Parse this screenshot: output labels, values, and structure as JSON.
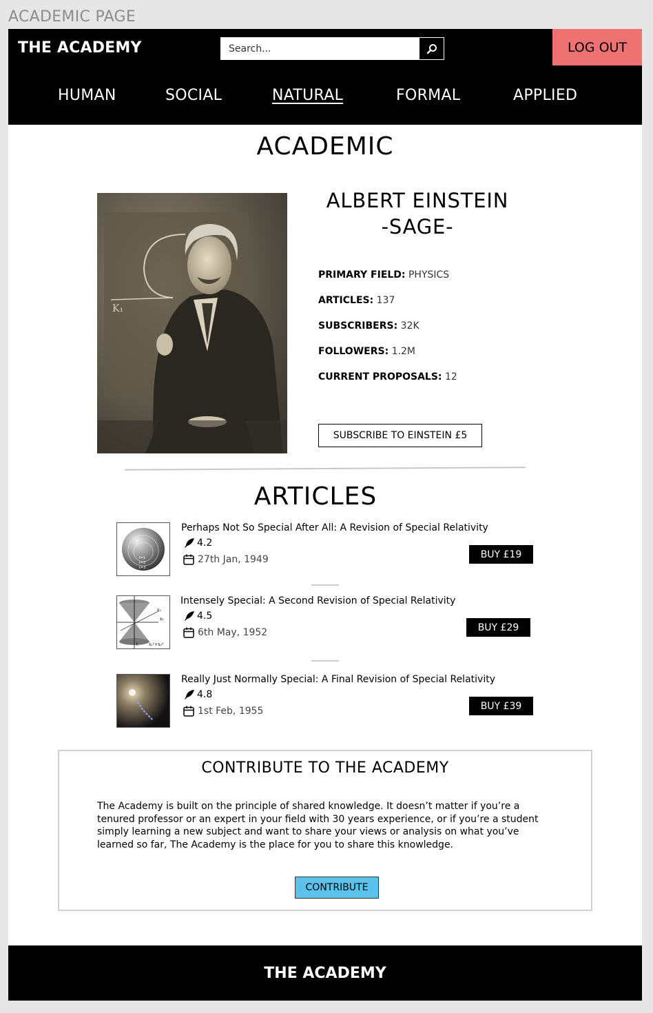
{
  "page_label": "ACADEMIC PAGE",
  "header": {
    "brand": "THE ACADEMY",
    "search_placeholder": "Search...",
    "logout_label": "LOG OUT"
  },
  "nav": {
    "items": [
      {
        "label": "HUMAN"
      },
      {
        "label": "SOCIAL"
      },
      {
        "label": "NATURAL",
        "active": true
      },
      {
        "label": "FORMAL"
      },
      {
        "label": "APPLIED"
      }
    ]
  },
  "page_title": "ACADEMIC",
  "profile": {
    "name": "ALBERT EINSTEIN",
    "rank": "-SAGE-",
    "stats": [
      {
        "label": "PRIMARY FIELD:",
        "value": "PHYSICS"
      },
      {
        "label": "ARTICLES:",
        "value": "137"
      },
      {
        "label": "SUBSCRIBERS:",
        "value": "32K"
      },
      {
        "label": "FOLLOWERS:",
        "value": "1.2M"
      },
      {
        "label": "CURRENT PROPOSALS:",
        "value": "12"
      }
    ],
    "subscribe_label": "SUBSCRIBE TO EINSTEIN £5"
  },
  "articles": {
    "title": "ARTICLES",
    "items": [
      {
        "title": "Perhaps Not So Special After All: A Revision of Special Relativity",
        "rating": "4.2",
        "date": "27th Jan, 1949",
        "buy_label": "BUY £19"
      },
      {
        "title": "Intensely Special: A Second Revision of Special Relativity",
        "rating": "4.5",
        "date": "6th May, 1952",
        "buy_label": "BUY £29"
      },
      {
        "title": "Really Just Normally Special: A Final Revision of Special Relativity",
        "rating": "4.8",
        "date": "1st Feb, 1955",
        "buy_label": "BUY £39"
      }
    ]
  },
  "contribute": {
    "title": "CONTRIBUTE TO THE ACADEMY",
    "text": "The Academy is built on the principle of shared knowledge. It doesn’t matter if you’re a tenured professor or an expert in your field with 30 years experience, or if you’re a student simply learning a new subject and want to share your views or analysis on what you’ve learned so far, The Academy is the place for you to share this knowledge.",
    "button_label": "CONTRIBUTE"
  },
  "footer": {
    "brand": "THE ACADEMY"
  },
  "colors": {
    "logout_bg": "#ee7272",
    "contribute_btn_bg": "#5bc2ee",
    "header_bg": "#000000"
  },
  "icons": [
    "search-icon",
    "quill-icon",
    "calendar-icon"
  ]
}
